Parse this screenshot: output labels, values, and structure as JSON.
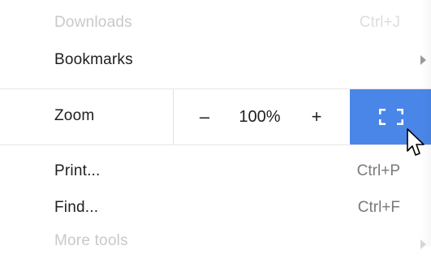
{
  "menu": {
    "downloads": {
      "label": "Downloads",
      "shortcut": "Ctrl+J"
    },
    "bookmarks": {
      "label": "Bookmarks"
    },
    "zoom": {
      "label": "Zoom",
      "minus": "–",
      "value": "100%",
      "plus": "+",
      "fullscreen_icon": "fullscreen-icon"
    },
    "print": {
      "label": "Print...",
      "shortcut": "Ctrl+P"
    },
    "find": {
      "label": "Find...",
      "shortcut": "Ctrl+F"
    },
    "more_tools": {
      "label": "More tools"
    }
  },
  "colors": {
    "accent": "#4a86e8",
    "text": "#202020",
    "shortcut": "#7a7a7a",
    "disabled": "#c9c9c9"
  }
}
